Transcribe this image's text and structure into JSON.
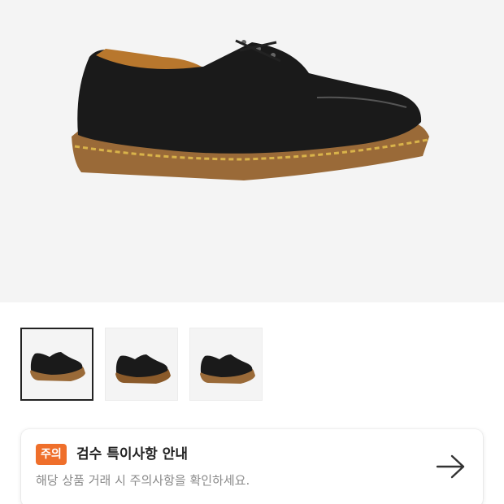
{
  "product": {
    "main_image": "black-leather-derby-shoe-yellow-stitch",
    "thumbnails": [
      {
        "name": "shoe-side-view",
        "active": true
      },
      {
        "name": "shoe-side-view-alt",
        "active": false
      },
      {
        "name": "shoe-side-view-alt2",
        "active": false
      }
    ]
  },
  "notice": {
    "badge": "주의",
    "title": "검수 특이사항 안내",
    "description": "해당 상품 거래 시 주의사항을 확인하세요.",
    "arrow_icon": "arrow-right-icon",
    "badge_color": "#ef6f2b"
  }
}
